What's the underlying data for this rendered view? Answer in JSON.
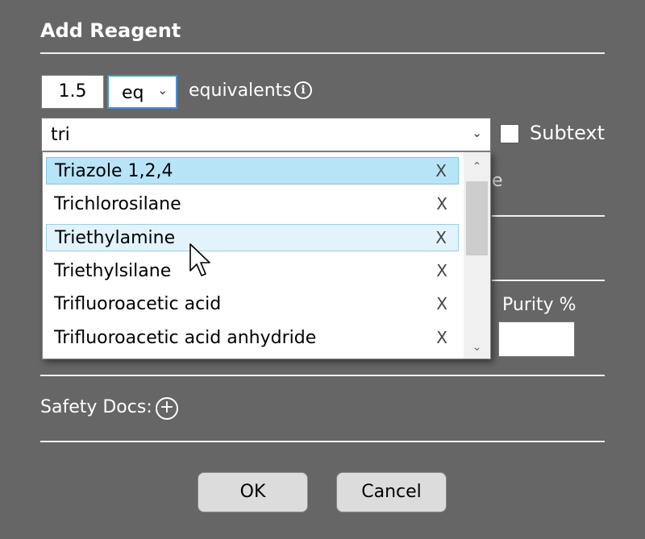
{
  "dialog": {
    "title": "Add Reagent"
  },
  "amount": {
    "value": "1.5",
    "unit": "eq",
    "label": "equivalents"
  },
  "search": {
    "value": "tri",
    "subtext_label": "Subtext",
    "subtext_checked": false
  },
  "dropdown": {
    "options": [
      {
        "label": "Triazole 1,2,4",
        "remove": "X",
        "state": "selected"
      },
      {
        "label": "Trichlorosilane",
        "remove": "X",
        "state": ""
      },
      {
        "label": "Triethylamine",
        "remove": "X",
        "state": "hover"
      },
      {
        "label": "Triethylsilane",
        "remove": "X",
        "state": ""
      },
      {
        "label": "Trifluoroacetic acid",
        "remove": "X",
        "state": ""
      },
      {
        "label": "Trifluoroacetic acid anhydride",
        "remove": "X",
        "state": ""
      }
    ]
  },
  "background": {
    "partial_text": "e"
  },
  "purity": {
    "label": "Purity %",
    "value": ""
  },
  "safety": {
    "label": "Safety Docs:"
  },
  "buttons": {
    "ok": "OK",
    "cancel": "Cancel"
  },
  "colors": {
    "background": "#666666",
    "selected_option": "#b8e4f8",
    "hover_option": "#e2f3fb",
    "focus_border": "#4a90d9"
  },
  "icons": {
    "info": "info-icon",
    "add": "plus-circle-icon",
    "chevron": "chevron-down-icon",
    "remove": "close-icon"
  }
}
